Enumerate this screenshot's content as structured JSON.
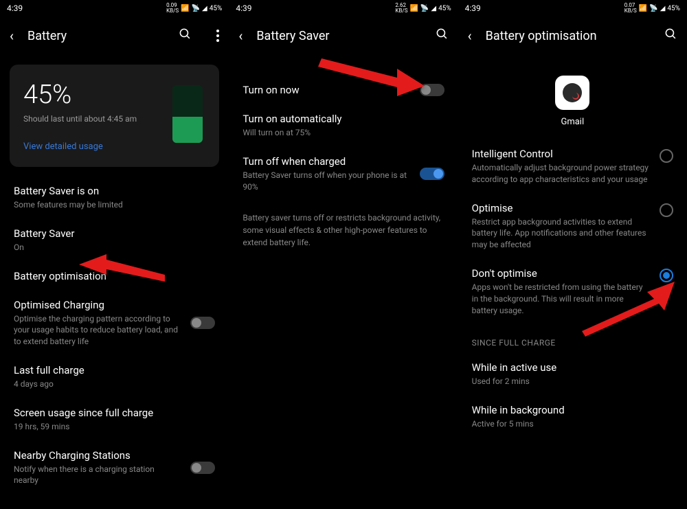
{
  "statusbar": {
    "time": "4:39",
    "battery": "45%",
    "speed1": "0.09",
    "speed2": "2.62",
    "speed3": "0.07",
    "speedUnit": "KB/S"
  },
  "screen1": {
    "title": "Battery",
    "card": {
      "percentage": "45%",
      "subtitle": "Should last until about 4:45 am",
      "link": "View detailed usage"
    },
    "items": {
      "saverStatus": {
        "title": "Battery Saver is on",
        "sub": "Some features may be limited"
      },
      "saver": {
        "title": "Battery Saver",
        "sub": "On"
      },
      "optimisation": {
        "title": "Battery optimisation"
      },
      "charging": {
        "title": "Optimised Charging",
        "sub": "Optimise the charging pattern according to your usage habits to reduce battery load, and to extend battery life"
      },
      "lastCharge": {
        "title": "Last full charge",
        "sub": "4 days ago"
      },
      "screenUsage": {
        "title": "Screen usage since full charge",
        "sub": "19 hrs, 59 mins"
      },
      "nearby": {
        "title": "Nearby Charging Stations",
        "sub": "Notify when there is a charging station nearby"
      }
    }
  },
  "screen2": {
    "title": "Battery Saver",
    "items": {
      "turnOn": {
        "title": "Turn on now"
      },
      "auto": {
        "title": "Turn on automatically",
        "sub": "Will turn on at 75%"
      },
      "turnOff": {
        "title": "Turn off when charged",
        "sub": "Battery Saver turns off when your phone is at 90%"
      }
    },
    "description": "Battery saver turns off or restricts background activity, some visual effects & other high-power features to extend battery life."
  },
  "screen3": {
    "title": "Battery optimisation",
    "appName": "Gmail",
    "options": {
      "intelligent": {
        "title": "Intelligent Control",
        "sub": "Automatically adjust background power strategy according to app characteristics and your usage"
      },
      "optimise": {
        "title": "Optimise",
        "sub": "Restrict app background activities to extend battery life. App notifications and other features may be affected"
      },
      "dontOptimise": {
        "title": "Don't optimise",
        "sub": "Apps won't be restricted from using the battery in the background. This will result in more battery usage."
      }
    },
    "sectionHeader": "SINCE FULL CHARGE",
    "stats": {
      "active": {
        "title": "While in active use",
        "sub": "Used for 2 mins"
      },
      "background": {
        "title": "While in background",
        "sub": "Active for 5 mins"
      }
    }
  }
}
